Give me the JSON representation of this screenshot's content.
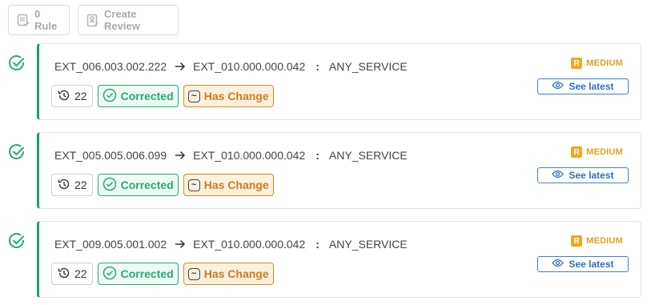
{
  "toolbar": {
    "rule_label": "0 Rule",
    "review_label": "Create Review"
  },
  "rows": [
    {
      "source": "EXT_006.003.002.222",
      "destination": "EXT_010.000.000.042",
      "service": "ANY_SERVICE",
      "count": "22",
      "corrected_label": "Corrected",
      "change_label": "Has Change",
      "severity_letter": "R",
      "severity_label": "MEDIUM",
      "see_latest_label": "See latest"
    },
    {
      "source": "EXT_005.005.006.099",
      "destination": "EXT_010.000.000.042",
      "service": "ANY_SERVICE",
      "count": "22",
      "corrected_label": "Corrected",
      "change_label": "Has Change",
      "severity_letter": "R",
      "severity_label": "MEDIUM",
      "see_latest_label": "See latest"
    },
    {
      "source": "EXT_009.005.001.002",
      "destination": "EXT_010.000.000.042",
      "service": "ANY_SERVICE",
      "count": "22",
      "corrected_label": "Corrected",
      "change_label": "Has Change",
      "severity_letter": "R",
      "severity_label": "MEDIUM",
      "see_latest_label": "See latest"
    }
  ],
  "colors": {
    "accent_green": "#1fae72",
    "change_orange": "#d48a2a",
    "severity_orange": "#f0a81e",
    "link_blue": "#2f6fc4"
  },
  "icons": [
    "rule-icon",
    "review-icon",
    "check-circle-icon",
    "arrow-right-icon",
    "history-icon",
    "tilde-icon",
    "eye-icon"
  ]
}
